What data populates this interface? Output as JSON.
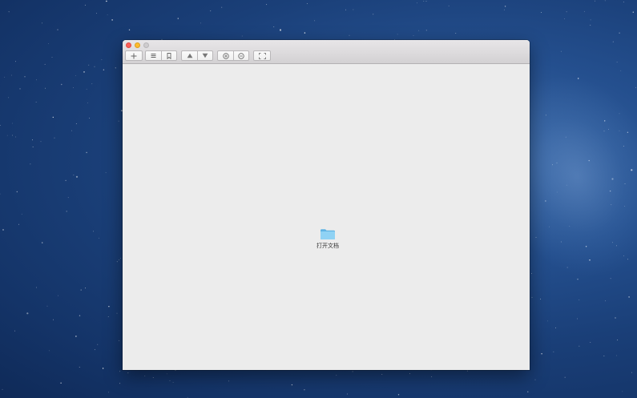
{
  "window": {
    "traffic_lights": [
      "close",
      "minimize",
      "zoom"
    ],
    "toolbar": {
      "buttons": [
        {
          "icon": "plus-icon",
          "glyph": "+"
        },
        {
          "icon": "list-icon",
          "glyph": "≡"
        },
        {
          "icon": "bookmark-icon",
          "glyph": ""
        },
        {
          "icon": "page-up-icon",
          "glyph": "▲"
        },
        {
          "icon": "page-down-icon",
          "glyph": "▼"
        },
        {
          "icon": "zoom-in-icon",
          "glyph": "⊕"
        },
        {
          "icon": "zoom-out-icon",
          "glyph": "⊖"
        },
        {
          "icon": "fullscreen-icon",
          "glyph": ""
        }
      ]
    },
    "content": {
      "open_document_label": "打开文档",
      "folder_color": "#7cc8ef"
    }
  }
}
